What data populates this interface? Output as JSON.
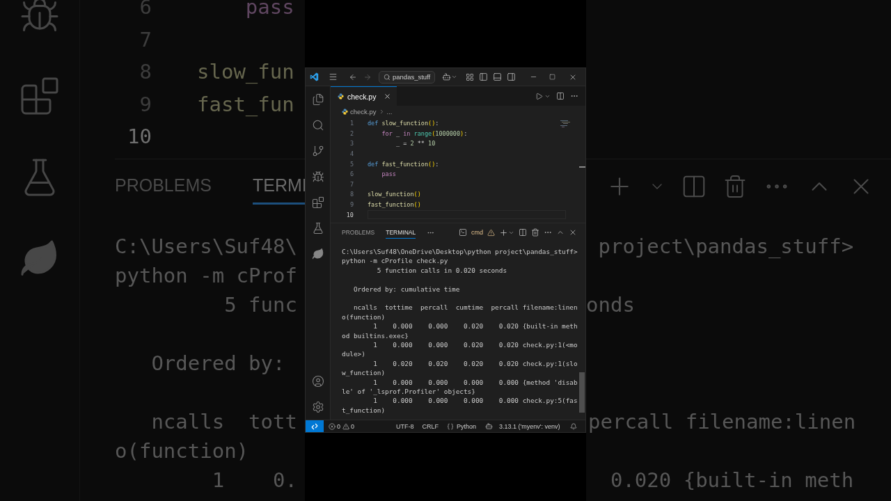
{
  "backdrop": {
    "left": {
      "editor_lines": [
        {
          "number": "6",
          "current": false,
          "code": "    pass",
          "kind": "control"
        },
        {
          "number": "7",
          "current": false
        },
        {
          "number": "8",
          "current": false,
          "code": "slow_fun",
          "kind": "function"
        },
        {
          "number": "9",
          "current": false,
          "code": "fast_fun",
          "kind": "function"
        },
        {
          "number": "10",
          "current": true
        }
      ],
      "panel_tabs": [
        {
          "label": "PROBLEMS",
          "selected": false
        },
        {
          "label": "TERMI",
          "selected": true
        }
      ],
      "terminal_lines": [
        "C:\\Users\\Suf48\\",
        "python -m cProf",
        "         5 func",
        "   Ordered by:",
        "   ncalls  tott",
        "o(function)",
        "        1    0."
      ]
    },
    "right": {
      "terminal_lines": [
        " project\\pandas_stuff>",
        "onds",
        "percall filename:linen",
        "  0.020 {built-in meth"
      ]
    }
  },
  "window": {
    "title_bar": {
      "search": "pandas_stuff"
    },
    "tabs": [
      {
        "label": "check.py",
        "selected": true
      }
    ],
    "breadcrumb": {
      "file": "check.py",
      "more": "..."
    },
    "code_lines": [
      {
        "number": "1",
        "current": false,
        "tokens": [
          {
            "kind": "keyword",
            "text": "def "
          },
          {
            "kind": "function",
            "text": "slow_function"
          },
          {
            "kind": "bracket",
            "text": "()"
          },
          {
            "kind": "plain",
            "text": ":"
          }
        ]
      },
      {
        "number": "2",
        "current": false,
        "tokens": [
          {
            "kind": "control",
            "text": "    for"
          },
          {
            "kind": "plain",
            "text": " _ "
          },
          {
            "kind": "control",
            "text": "in"
          },
          {
            "kind": "builtin",
            "text": " range"
          },
          {
            "kind": "bracket",
            "text": "("
          },
          {
            "kind": "number",
            "text": "1000000"
          },
          {
            "kind": "bracket",
            "text": ")"
          },
          {
            "kind": "plain",
            "text": ":"
          }
        ]
      },
      {
        "number": "3",
        "current": false,
        "tokens": [
          {
            "kind": "plain",
            "text": "        _ = "
          },
          {
            "kind": "number",
            "text": "2"
          },
          {
            "kind": "plain",
            "text": " ** "
          },
          {
            "kind": "number",
            "text": "10"
          }
        ]
      },
      {
        "number": "4",
        "current": false
      },
      {
        "number": "5",
        "current": false,
        "tokens": [
          {
            "kind": "keyword",
            "text": "def "
          },
          {
            "kind": "function",
            "text": "fast_function"
          },
          {
            "kind": "bracket",
            "text": "()"
          },
          {
            "kind": "plain",
            "text": ":"
          }
        ]
      },
      {
        "number": "6",
        "current": false,
        "tokens": [
          {
            "kind": "control",
            "text": "    pass"
          }
        ]
      },
      {
        "number": "7",
        "current": false
      },
      {
        "number": "8",
        "current": false,
        "tokens": [
          {
            "kind": "function",
            "text": "slow_function"
          },
          {
            "kind": "bracket",
            "text": "()"
          }
        ]
      },
      {
        "number": "9",
        "current": false,
        "tokens": [
          {
            "kind": "function",
            "text": "fast_function"
          },
          {
            "kind": "bracket",
            "text": "()"
          }
        ]
      },
      {
        "number": "10",
        "current": true
      }
    ],
    "panel": {
      "tabs": [
        {
          "label": "PROBLEMS",
          "selected": false
        },
        {
          "label": "TERMINAL",
          "selected": true
        }
      ],
      "shell": "cmd"
    },
    "terminal_blocks": [
      [
        "C:\\Users\\Suf48\\OneDrive\\Desktop\\python project\\pandas_stuff>",
        "python -m cProfile check.py",
        "         5 function calls in 0.020 seconds"
      ],
      [
        "   Ordered by: cumulative time"
      ],
      [
        "   ncalls  tottime  percall  cumtime  percall filename:linen",
        "o(function)",
        "        1    0.000    0.000    0.020    0.020 {built-in meth",
        "od builtins.exec}",
        "        1    0.000    0.000    0.020    0.020 check.py:1(<mo",
        "dule>)",
        "        1    0.020    0.020    0.020    0.020 check.py:1(slo",
        "w_function)",
        "        1    0.000    0.000    0.000    0.000 {method 'disab",
        "le' of '_lsprof.Profiler' objects}",
        "        1    0.000    0.000    0.000    0.000 check.py:5(fas",
        "t_function)"
      ]
    ],
    "status_bar": {
      "errors": "0",
      "warnings": "0",
      "encoding": "UTF-8",
      "eol": "CRLF",
      "language": "Python",
      "interpreter": "3.13.1 ('myenv': venv)"
    }
  }
}
